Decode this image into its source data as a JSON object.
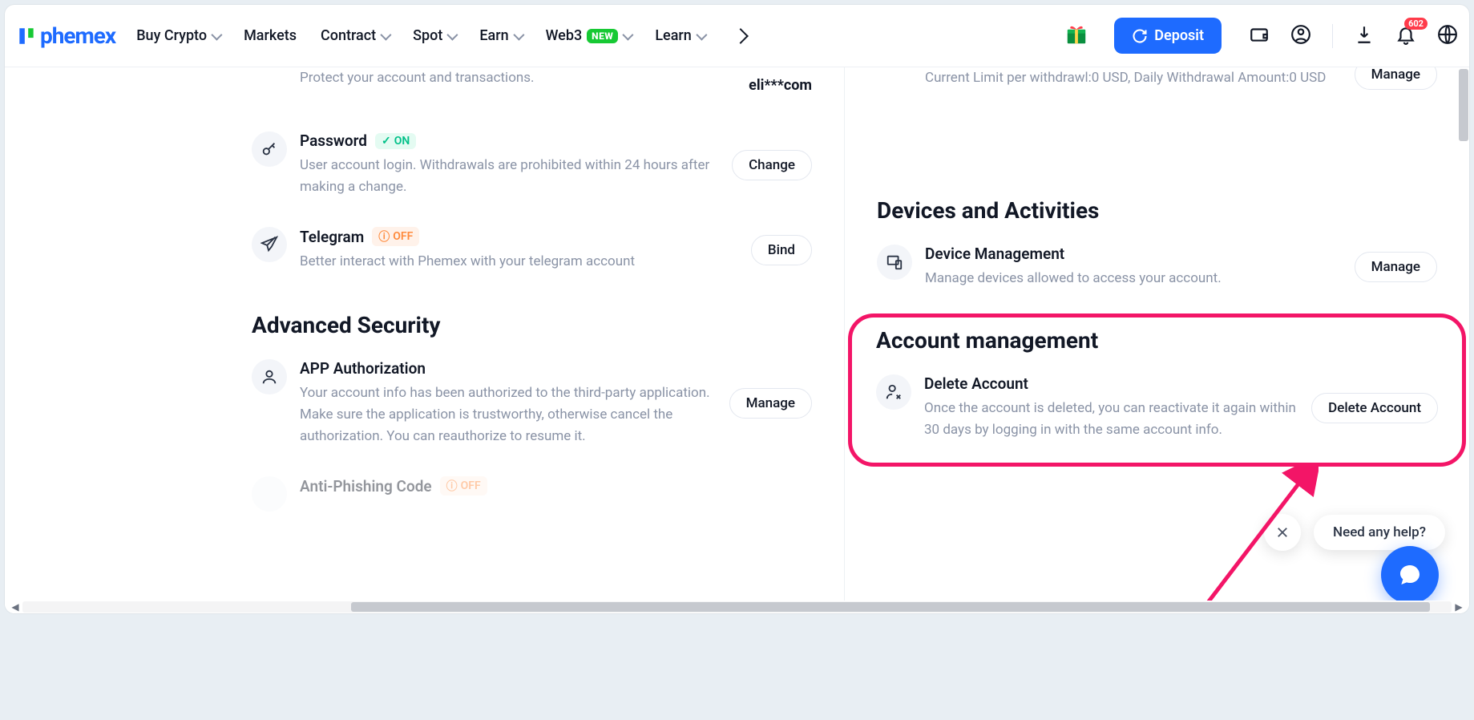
{
  "brand": "phemex",
  "nav": {
    "buy_crypto": "Buy Crypto",
    "markets": "Markets",
    "contract": "Contract",
    "spot": "Spot",
    "earn": "Earn",
    "web3": "Web3",
    "web3_badge": "NEW",
    "learn": "Learn"
  },
  "deposit_label": "Deposit",
  "notif_count": "602",
  "left": {
    "email_desc": "Protect your account and transactions.",
    "email_value": "eli***com",
    "password": {
      "title": "Password",
      "status": "ON",
      "desc": "User account login. Withdrawals are prohibited within 24 hours after making a change.",
      "btn": "Change"
    },
    "telegram": {
      "title": "Telegram",
      "status": "OFF",
      "desc": "Better interact with Phemex with your telegram account",
      "btn": "Bind"
    },
    "advanced_title": "Advanced Security",
    "app_auth": {
      "title": "APP Authorization",
      "desc": "Your account info has been authorized to the third-party application. Make sure the application is trustworthy, otherwise cancel the authorization. You can reauthorize to resume it.",
      "btn": "Manage"
    },
    "antiphish": {
      "title": "Anti-Phishing Code",
      "status": "OFF"
    }
  },
  "right": {
    "withdrawal_desc": "Current Limit per withdrawl:0 USD, Daily Withdrawal Amount:0 USD",
    "withdrawal_btn": "Manage",
    "devices_title": "Devices and Activities",
    "device_mgmt": {
      "title": "Device Management",
      "desc": "Manage devices allowed to access your account.",
      "btn": "Manage"
    },
    "account_title": "Account management",
    "delete": {
      "title": "Delete Account",
      "desc": "Once the account is deleted, you can reactivate it again within 30 days by logging in with the same account info.",
      "btn": "Delete Account"
    }
  },
  "help_text": "Need any help?"
}
